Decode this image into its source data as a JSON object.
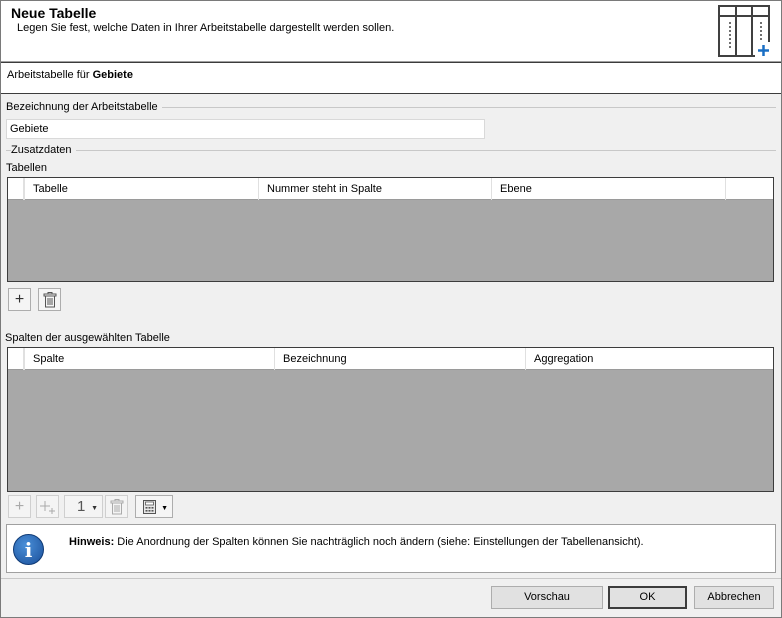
{
  "header": {
    "title": "Neue Tabelle",
    "subtitle": "Legen Sie fest, welche Daten in Ihrer Arbeitstabelle dargestellt werden sollen.",
    "icon": "table-add-icon"
  },
  "context": {
    "prefix": "Arbeitstabelle für",
    "name": "Gebiete"
  },
  "name_group": {
    "label": "Bezeichnung der Arbeitstabelle",
    "value": "Gebiete"
  },
  "extra_group": {
    "label": "Zusatzdaten"
  },
  "tables": {
    "label": "Tabellen",
    "columns": [
      "Tabelle",
      "Nummer steht in Spalte",
      "Ebene"
    ],
    "rows": []
  },
  "columns_section": {
    "label": "Spalten der ausgewählten Tabelle",
    "columns": [
      "Spalte",
      "Bezeichnung",
      "Aggregation"
    ],
    "rows": [],
    "spin_value": "1"
  },
  "info": {
    "bold": "Hinweis:",
    "text": " Die Anordnung der Spalten können Sie nachträglich noch ändern (siehe: Einstellungen der Tabellenansicht)."
  },
  "buttons": {
    "preview": "Vorschau",
    "ok": "OK",
    "cancel": "Abbrechen"
  }
}
